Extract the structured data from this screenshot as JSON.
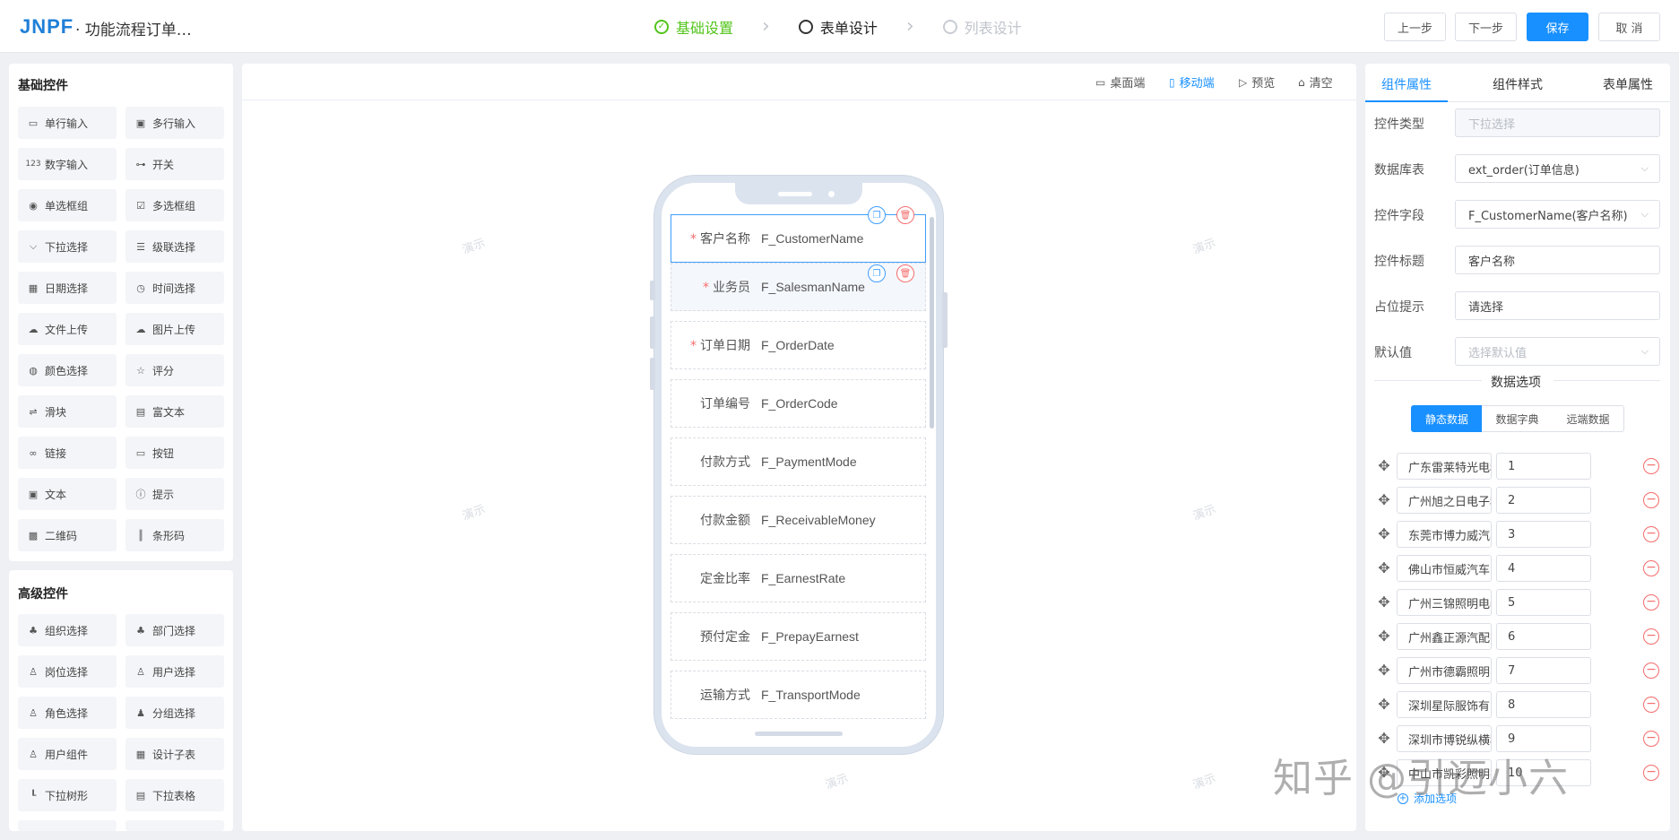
{
  "header": {
    "logo_text": "JNPF",
    "title": "· 功能流程订单…",
    "steps": [
      {
        "label": "基础设置",
        "state": "done"
      },
      {
        "label": "表单设计",
        "state": "active"
      },
      {
        "label": "列表设计",
        "state": "todo"
      }
    ],
    "buttons": {
      "prev": "上一步",
      "next": "下一步",
      "save": "保存",
      "cancel": "取 消"
    }
  },
  "left": {
    "basic_title": "基础控件",
    "basic_controls": [
      {
        "label": "单行输入",
        "icon": "input-icon"
      },
      {
        "label": "多行输入",
        "icon": "textarea-icon"
      },
      {
        "label": "数字输入",
        "icon": "number-icon"
      },
      {
        "label": "开关",
        "icon": "switch-icon"
      },
      {
        "label": "单选框组",
        "icon": "radio-icon"
      },
      {
        "label": "多选框组",
        "icon": "checkbox-icon"
      },
      {
        "label": "下拉选择",
        "icon": "select-icon"
      },
      {
        "label": "级联选择",
        "icon": "cascader-icon"
      },
      {
        "label": "日期选择",
        "icon": "calendar-icon"
      },
      {
        "label": "时间选择",
        "icon": "clock-icon"
      },
      {
        "label": "文件上传",
        "icon": "upload-icon"
      },
      {
        "label": "图片上传",
        "icon": "image-upload-icon"
      },
      {
        "label": "颜色选择",
        "icon": "palette-icon"
      },
      {
        "label": "评分",
        "icon": "star-icon"
      },
      {
        "label": "滑块",
        "icon": "slider-icon"
      },
      {
        "label": "富文本",
        "icon": "richtext-icon"
      },
      {
        "label": "链接",
        "icon": "link-icon"
      },
      {
        "label": "按钮",
        "icon": "button-icon"
      },
      {
        "label": "文本",
        "icon": "text-icon"
      },
      {
        "label": "提示",
        "icon": "alert-icon"
      },
      {
        "label": "二维码",
        "icon": "qrcode-icon"
      },
      {
        "label": "条形码",
        "icon": "barcode-icon"
      }
    ],
    "advanced_title": "高级控件",
    "advanced_controls": [
      {
        "label": "组织选择",
        "icon": "org-icon"
      },
      {
        "label": "部门选择",
        "icon": "department-icon"
      },
      {
        "label": "岗位选择",
        "icon": "position-icon"
      },
      {
        "label": "用户选择",
        "icon": "user-icon"
      },
      {
        "label": "角色选择",
        "icon": "role-icon"
      },
      {
        "label": "分组选择",
        "icon": "group-icon"
      },
      {
        "label": "用户组件",
        "icon": "user-component-icon"
      },
      {
        "label": "设计子表",
        "icon": "table-icon"
      },
      {
        "label": "下拉树形",
        "icon": "tree-icon"
      },
      {
        "label": "下拉表格",
        "icon": "table-select-icon"
      }
    ]
  },
  "canvas": {
    "toolbar": {
      "desktop": "桌面端",
      "mobile": "移动端",
      "preview": "预览",
      "clear": "清空"
    },
    "fields": [
      {
        "label": "客户名称",
        "value": "F_CustomerName",
        "required": true
      },
      {
        "label": "业务员",
        "value": "F_SalesmanName",
        "required": true
      },
      {
        "label": "订单日期",
        "value": "F_OrderDate",
        "required": true
      },
      {
        "label": "订单编号",
        "value": "F_OrderCode",
        "required": false
      },
      {
        "label": "付款方式",
        "value": "F_PaymentMode",
        "required": false
      },
      {
        "label": "付款金额",
        "value": "F_ReceivableMoney",
        "required": false
      },
      {
        "label": "定金比率",
        "value": "F_EarnestRate",
        "required": false
      },
      {
        "label": "预付定金",
        "value": "F_PrepayEarnest",
        "required": false
      },
      {
        "label": "运输方式",
        "value": "F_TransportMode",
        "required": false
      }
    ],
    "required_mark": "*",
    "watermark": "演示"
  },
  "right": {
    "tabs": [
      "组件属性",
      "组件样式",
      "表单属性"
    ],
    "props": [
      {
        "label": "控件类型",
        "value": "下拉选择",
        "style": "disabled"
      },
      {
        "label": "数据库表",
        "value": "ext_order(订单信息)",
        "style": "select"
      },
      {
        "label": "控件字段",
        "value": "F_CustomerName(客户名称)",
        "style": "select"
      },
      {
        "label": "控件标题",
        "value": "客户名称",
        "style": "text"
      },
      {
        "label": "占位提示",
        "value": "请选择",
        "style": "text"
      },
      {
        "label": "默认值",
        "value": "选择默认值",
        "style": "placeholder-select"
      }
    ],
    "options_title": "数据选项",
    "source_tabs": [
      "静态数据",
      "数据字典",
      "远端数据"
    ],
    "options": [
      {
        "label": "广东雷莱特光电科",
        "value": "1"
      },
      {
        "label": "广州旭之日电子科",
        "value": "2"
      },
      {
        "label": "东莞市博力威汽车",
        "value": "3"
      },
      {
        "label": "佛山市恒威汽车",
        "value": "4"
      },
      {
        "label": "广州三锦照明电器",
        "value": "5"
      },
      {
        "label": "广州鑫正源汽配有",
        "value": "6"
      },
      {
        "label": "广州市德霸照明电",
        "value": "7"
      },
      {
        "label": "深圳星际服饰有限",
        "value": "8"
      },
      {
        "label": "深圳市博锐纵横科",
        "value": "9"
      },
      {
        "label": "中山市凯彩照明有",
        "value": "10"
      }
    ],
    "add_option": "添加选项"
  },
  "overlay_watermark": "知乎 @引迈小六",
  "colors": {
    "primary": "#1890ff",
    "success": "#52c41a",
    "danger": "#f56c6c"
  }
}
